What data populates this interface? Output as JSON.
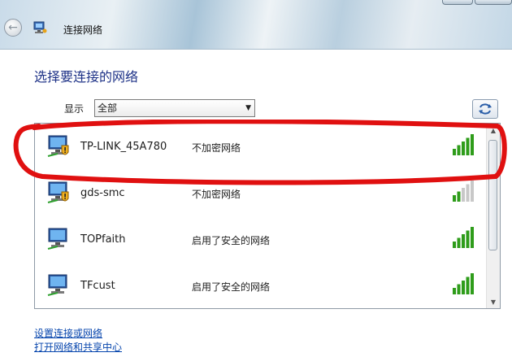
{
  "window": {
    "title": "连接网络"
  },
  "dialog": {
    "heading": "选择要连接的网络",
    "filter_label": "显示",
    "filter_value": "全部"
  },
  "networks": [
    {
      "ssid": "TP-LINK_45A780",
      "security": "不加密网络",
      "signal": 5,
      "shield": true
    },
    {
      "ssid": "gds-smc",
      "security": "不加密网络",
      "signal": 2,
      "shield": true
    },
    {
      "ssid": "TOPfaith",
      "security": "启用了安全的网络",
      "signal": 5,
      "shield": false
    },
    {
      "ssid": "TFcust",
      "security": "启用了安全的网络",
      "signal": 5,
      "shield": false
    }
  ],
  "links": {
    "setup": "设置连接或网络",
    "open_center": "打开网络和共享中心"
  },
  "colors": {
    "signal_on": "#2e9c1a",
    "signal_off": "#c8c8c8",
    "heading": "#1e3287",
    "link": "#0645ad",
    "annotation": "#e01010"
  },
  "icons": {
    "back": "back-arrow-icon",
    "title": "network-icon",
    "refresh": "refresh-icon",
    "network": "monitor-network-icon",
    "signal": "signal-bars-icon",
    "warning": "warning-shield-icon"
  }
}
